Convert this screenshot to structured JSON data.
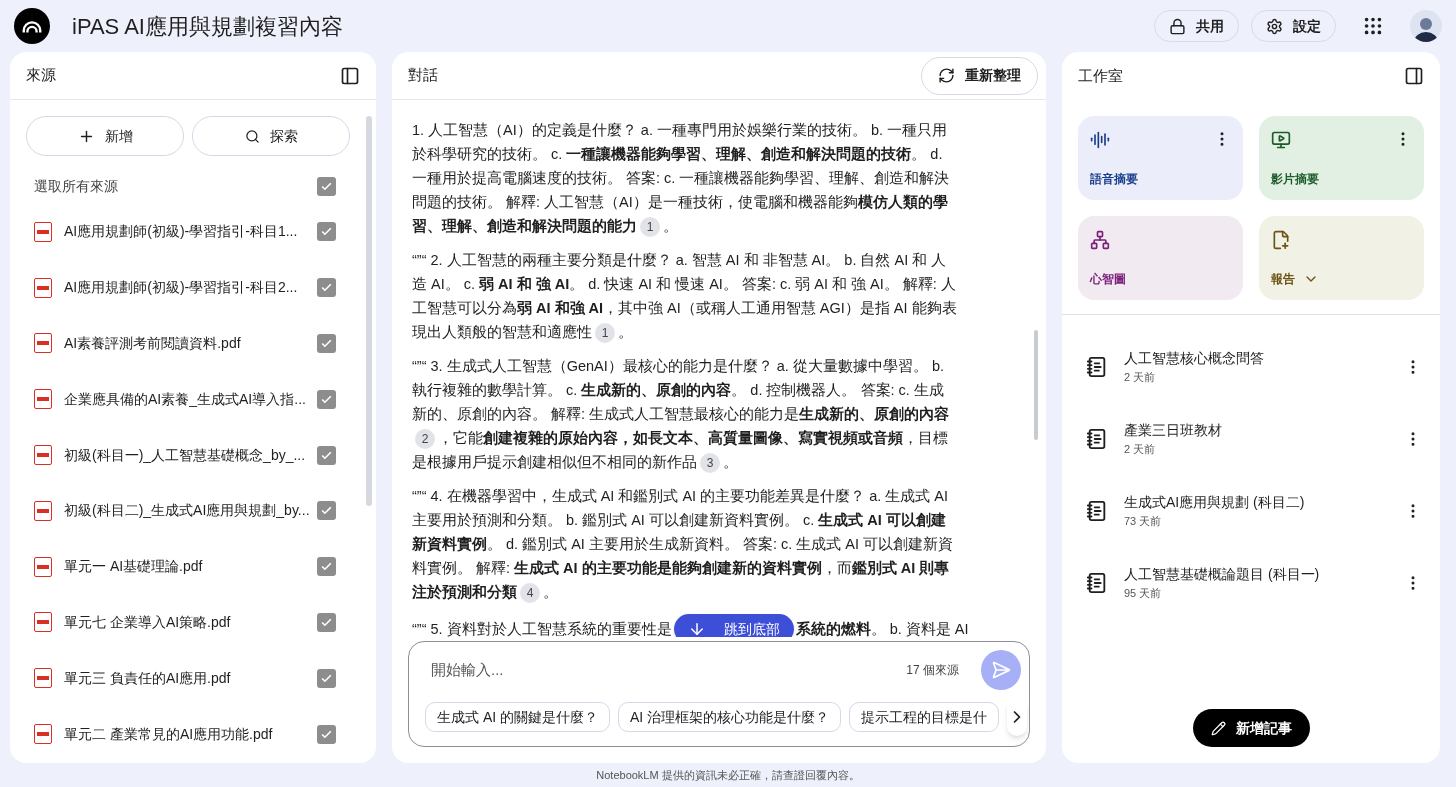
{
  "header": {
    "title": "iPAS AI應用與規劃複習內容",
    "buttons": [
      {
        "kind": "share",
        "label": "共用"
      },
      {
        "kind": "settings",
        "label": "設定"
      }
    ]
  },
  "sources": {
    "title": "來源",
    "add_label": "新增",
    "explore_label": "探索",
    "select_all": {
      "label": "選取所有來源",
      "checked": true
    },
    "items": [
      {
        "name": "AI應用規劃師(初級)-學習指引-科目1...",
        "checked": true
      },
      {
        "name": "AI應用規劃師(初級)-學習指引-科目2...",
        "checked": true
      },
      {
        "name": "AI素養評測考前閱讀資料.pdf",
        "checked": true
      },
      {
        "name": "企業應具備的AI素養_生成式AI導入指...",
        "checked": true
      },
      {
        "name": "初級(科目一)_人工智慧基礎概念_by_...",
        "checked": true
      },
      {
        "name": "初級(科目二)_生成式AI應用與規劃_by...",
        "checked": true
      },
      {
        "name": "單元一 AI基礎理論.pdf",
        "checked": true
      },
      {
        "name": "單元七 企業導入AI策略.pdf",
        "checked": true
      },
      {
        "name": "單元三 負責任的AI應用.pdf",
        "checked": true
      },
      {
        "name": "單元二 產業常見的AI應用功能.pdf",
        "checked": true
      }
    ]
  },
  "chat": {
    "title": "對話",
    "refresh_label": "重新整理",
    "paragraphs": [
      [
        {
          "kind": "text",
          "text": "1. 人工智慧（AI）的定義是什麼？ a. 一種專門用於娛樂行業的技術。 b. 一種只用於科學研究的技術。 c. **一種讓機器能夠學習、理解、創造和解決問題的技術**。 d. 一種用於提高電腦速度的技術。 答案: c. 一種讓機器能夠學習、理解、創造和解決問題的技術。 解釋: 人工智慧（AI）是一種技術，使電腦和機器能夠**模仿人類的學習、理解、創造和解決問題的能力**"
        },
        {
          "kind": "cite",
          "text": "1"
        },
        {
          "kind": "text",
          "text": "。"
        }
      ],
      [
        {
          "kind": "text",
          "text": "“”“ 2. 人工智慧的兩種主要分類是什麼？ a. 智慧 AI 和 非智慧 AI。 b. 自然 AI 和 人造 AI。 c. **弱 AI 和 強 AI**。 d. 快速 AI 和 慢速 AI。 答案: c. 弱 AI 和 強 AI。 解釋: 人工智慧可以分為**弱 AI 和強 AI**，其中強 AI（或稱人工通用智慧 AGI）是指 AI 能夠表現出人類般的智慧和適應性"
        },
        {
          "kind": "cite",
          "text": "1"
        },
        {
          "kind": "text",
          "text": "。"
        }
      ],
      [
        {
          "kind": "text",
          "text": "“”“ 3. 生成式人工智慧（GenAI）最核心的能力是什麼？ a. 從大量數據中學習。 b. 執行複雜的數學計算。 c. **生成新的、原創的內容**。 d. 控制機器人。 答案: c. 生成新的、原創的內容。 解釋: 生成式人工智慧最核心的能力是**生成新的、原創的內容**"
        },
        {
          "kind": "cite",
          "text": "2"
        },
        {
          "kind": "text",
          "text": "，它能**創建複雜的原始內容，如長文本、高質量圖像、寫實視頻或音頻**，目標是根據用戶提示創建相似但不相同的新作品"
        },
        {
          "kind": "cite",
          "text": "3"
        },
        {
          "kind": "text",
          "text": "。"
        }
      ],
      [
        {
          "kind": "text",
          "text": "“”“ 4. 在機器學習中，生成式 AI 和鑑別式 AI 的主要功能差異是什麼？ a. 生成式 AI 主要用於預測和分類。 b. 鑑別式 AI 可以創建新資料實例。 c. **生成式 AI 可以創建新資料實例**。 d. 鑑別式 AI 主要用於生成新資料。 答案: c. 生成式 AI 可以創建新資料實例。 解釋: **生成式 AI 的主要功能是能夠創建新的資料實例**，而**鑑別式 AI 則專注於預測和分類**"
        },
        {
          "kind": "cite",
          "text": "4"
        },
        {
          "kind": "text",
          "text": "。"
        }
      ],
      [
        {
          "kind": "text",
          "text": "“”“ 5. 資料對於人工智慧系統的重要性是"
        },
        {
          "kind": "jump"
        },
        {
          "kind": "text",
          "text": "**系統的燃料**。 b. 資料是 AI"
        }
      ]
    ],
    "jump_label": "跳到底部",
    "input": {
      "placeholder": "開始輸入...",
      "source_count": "17 個來源"
    },
    "suggestions": [
      "生成式 AI 的關鍵是什麼？",
      "AI 治理框架的核心功能是什麼？",
      "提示工程的目標是什"
    ]
  },
  "studio": {
    "title": "工作室",
    "tiles": [
      {
        "kind": "audio",
        "label": "語音摘要",
        "color": "#1a3e8c"
      },
      {
        "kind": "video",
        "label": "影片摘要",
        "color": "#1e5b2a"
      },
      {
        "kind": "mindmap",
        "label": "心智圖",
        "color": "#7a1f7a"
      },
      {
        "kind": "report",
        "label": "報告",
        "color": "#6b5416"
      }
    ],
    "notes": [
      {
        "title": "人工智慧核心概念問答",
        "time": "2 天前"
      },
      {
        "title": "產業三日班教材",
        "time": "2 天前"
      },
      {
        "title": "生成式AI應用與規劃 (科目二)",
        "time": "73 天前"
      },
      {
        "title": "人工智慧基礎概論題目 (科目一)",
        "time": "95 天前"
      }
    ],
    "add_note_label": "新增記事"
  },
  "footer": "NotebookLM 提供的資訊未必正確，請查證回覆內容。"
}
